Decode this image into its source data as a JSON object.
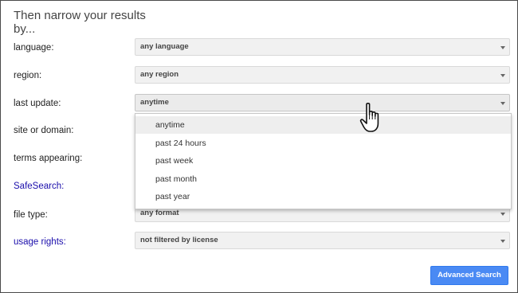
{
  "heading": "Then narrow your results by...",
  "rows": [
    {
      "label": "language:",
      "value": "any language"
    },
    {
      "label": "region:",
      "value": "any region"
    },
    {
      "label": "last update:",
      "value": "anytime"
    },
    {
      "label": "site or domain:"
    },
    {
      "label": "terms appearing:"
    },
    {
      "label": "SafeSearch:"
    },
    {
      "label": "file type:",
      "value": "any format"
    },
    {
      "label": "usage rights:",
      "value": "not filtered by license"
    }
  ],
  "dropdown": {
    "options": [
      "anytime",
      "past 24 hours",
      "past week",
      "past month",
      "past year"
    ],
    "selected": "anytime"
  },
  "submit_label": "Advanced Search",
  "colors": {
    "link": "#1a0dab",
    "button": "#4a8af4"
  },
  "icons": {
    "cursor": "hand-pointer-icon",
    "dropdown_arrow": "caret-down-icon"
  }
}
